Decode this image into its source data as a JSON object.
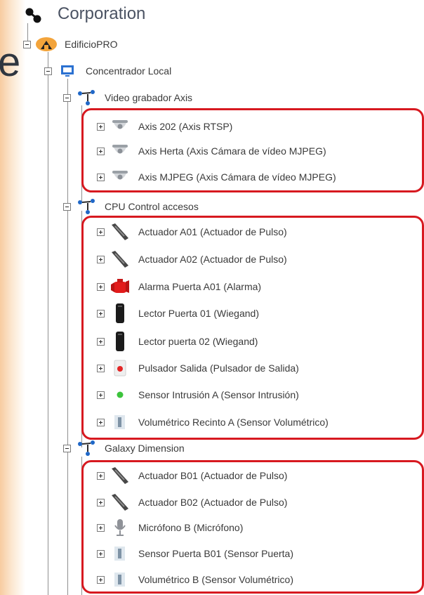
{
  "root": {
    "title": "Corporation",
    "icon": "corporation-icon"
  },
  "tree": {
    "building": {
      "label": "EdificioPRO",
      "icon": "building-icon"
    },
    "local_hub": {
      "label": "Concentrador Local",
      "icon": "monitor-icon"
    },
    "groups": [
      {
        "label": "Video grabador Axis",
        "icon": "network-node-icon",
        "items": [
          {
            "label": "Axis 202 (Axis RTSP)",
            "icon": "dome-camera-icon"
          },
          {
            "label": "Axis Herta (Axis Cámara de vídeo MJPEG)",
            "icon": "dome-camera-icon"
          },
          {
            "label": "Axis MJPEG (Axis Cámara de vídeo MJPEG)",
            "icon": "dome-camera-icon"
          }
        ]
      },
      {
        "label": "CPU Control accesos",
        "icon": "network-node-icon",
        "items": [
          {
            "label": "Actuador A01 (Actuador de Pulso)",
            "icon": "strike-actuator-icon"
          },
          {
            "label": "Actuador A02 (Actuador de Pulso)",
            "icon": "strike-actuator-icon"
          },
          {
            "label": "Alarma Puerta A01 (Alarma)",
            "icon": "alarm-siren-icon"
          },
          {
            "label": "Lector Puerta 01 (Wiegand)",
            "icon": "card-reader-icon"
          },
          {
            "label": "Lector puerta 02 (Wiegand)",
            "icon": "card-reader-icon"
          },
          {
            "label": "Pulsador Salida (Pulsador de Salida)",
            "icon": "exit-button-icon"
          },
          {
            "label": "Sensor Intrusión A (Sensor Intrusión)",
            "icon": "intrusion-sensor-icon"
          },
          {
            "label": "Volumétrico Recinto A (Sensor Volumétrico)",
            "icon": "volumetric-sensor-icon"
          }
        ]
      },
      {
        "label": "Galaxy Dimension",
        "icon": "network-node-icon",
        "items": [
          {
            "label": "Actuador B01 (Actuador de Pulso)",
            "icon": "strike-actuator-icon"
          },
          {
            "label": "Actuador B02 (Actuador de Pulso)",
            "icon": "strike-actuator-icon"
          },
          {
            "label": "Micrófono B (Micrófono)",
            "icon": "microphone-icon"
          },
          {
            "label": "Sensor Puerta B01 (Sensor Puerta)",
            "icon": "door-sensor-icon"
          },
          {
            "label": "Volumétrico B (Sensor Volumétrico)",
            "icon": "volumetric-sensor-icon"
          }
        ]
      }
    ]
  },
  "colors": {
    "callout": "#d71920",
    "text": "#3a3a3a",
    "title": "#4b5363"
  },
  "partial_text": {
    "cut_letter": "e"
  }
}
